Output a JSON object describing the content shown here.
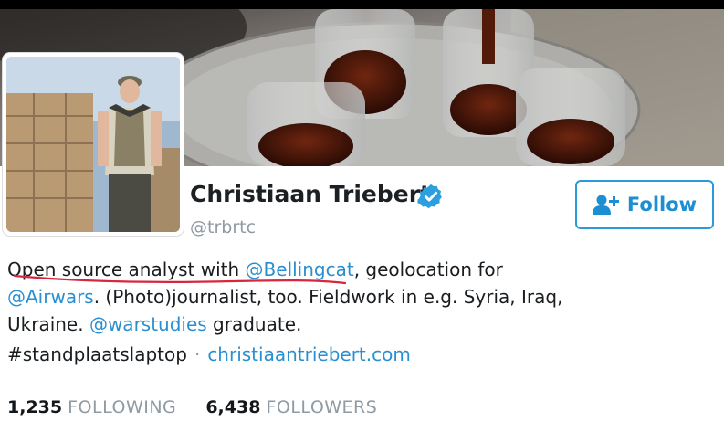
{
  "profile": {
    "name": "Christiaan Triebert",
    "handle": "@trbrtc",
    "verified": true,
    "follow_label": "Follow"
  },
  "bio": {
    "line1": {
      "t1": "Open source analyst with ",
      "m1": "@Bellingcat",
      "t2": ", geolocation for"
    },
    "line2": {
      "m1": "@Airwars",
      "t1": ". (Photo)journalist, too. Fieldwork in e.g. Syria, Iraq,"
    },
    "line3": {
      "t1": "Ukraine. ",
      "m1": "@warstudies",
      "t2": " graduate."
    }
  },
  "meta": {
    "location": "#standplaatslaptop",
    "separator": "·",
    "website": "christiaantriebert.com"
  },
  "stats": {
    "following_count": "1,235",
    "following_label": "FOLLOWING",
    "followers_count": "6,438",
    "followers_label": "FOLLOWERS"
  },
  "colors": {
    "link": "#2a8fd0",
    "follow_border": "#2b9bd8",
    "muted": "#8f9aa3",
    "annotation": "#d7263d"
  }
}
